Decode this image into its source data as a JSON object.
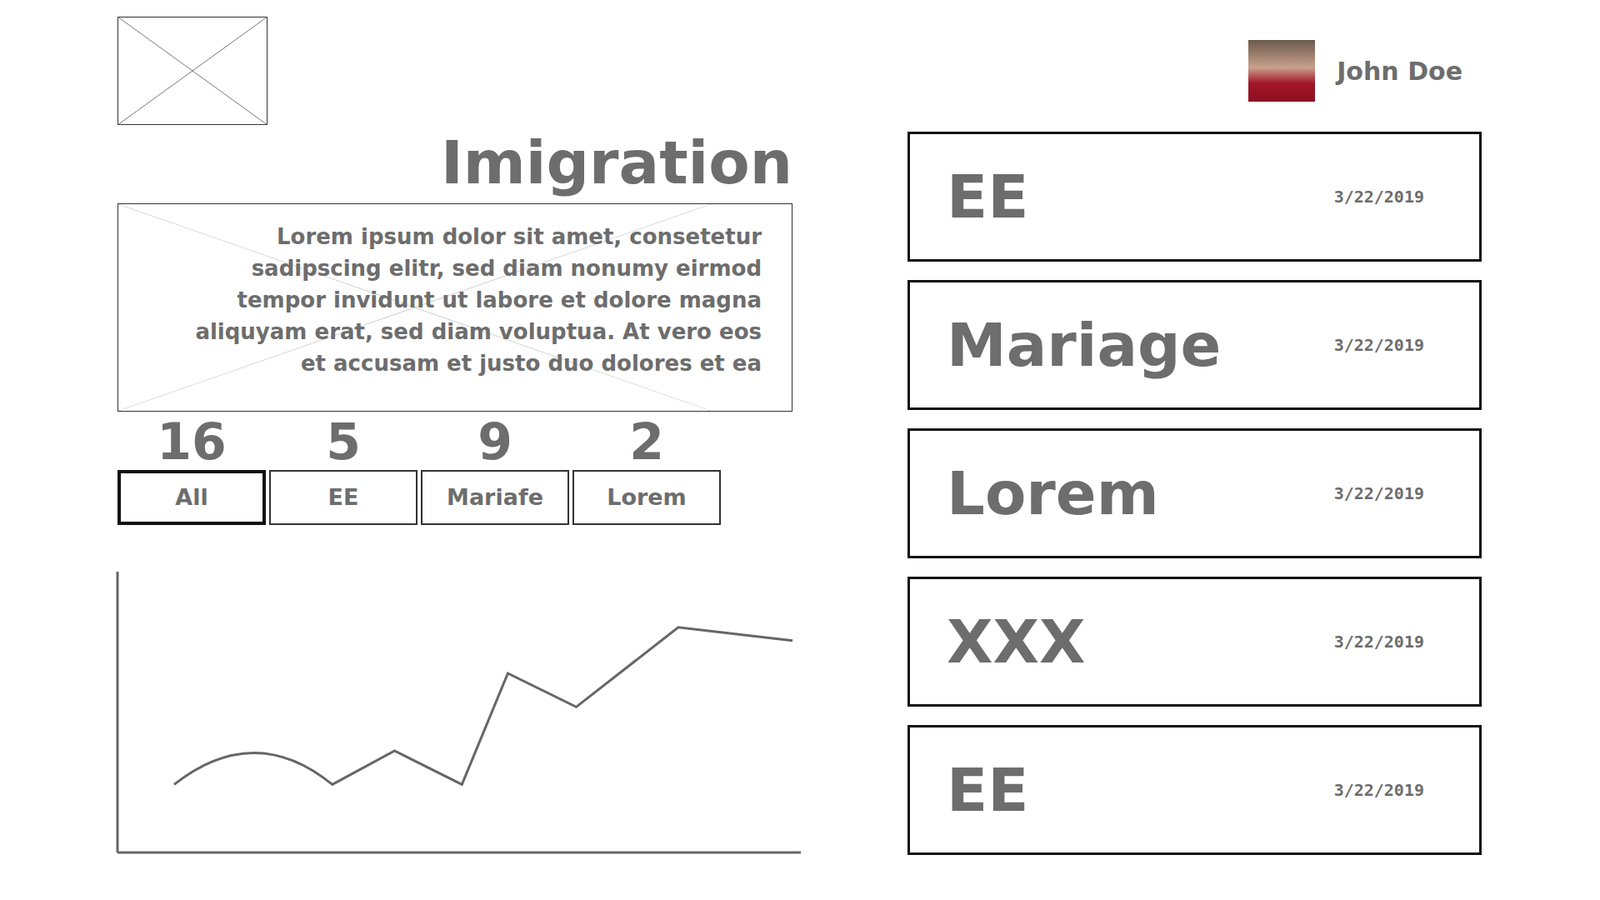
{
  "header": {
    "title": "Imigration",
    "description": "Lorem ipsum dolor sit amet, consetetur sadipscing elitr, sed diam nonumy eirmod tempor invidunt ut labore et dolore magna aliquyam erat, sed diam voluptua. At vero eos et accusam et justo duo dolores et ea"
  },
  "user": {
    "name": "John Doe"
  },
  "filters": [
    {
      "label": "All",
      "count": "16",
      "selected": true
    },
    {
      "label": "EE",
      "count": "5",
      "selected": false
    },
    {
      "label": "Mariafe",
      "count": "9",
      "selected": false
    },
    {
      "label": "Lorem",
      "count": "2",
      "selected": false
    }
  ],
  "chart": {
    "series": [
      {
        "x": [
          0,
          79,
          155,
          216,
          282,
          327,
          394,
          494,
          606
        ],
        "values": [
          65,
          96,
          65,
          98,
          65,
          174,
          141,
          219,
          206
        ]
      }
    ]
  },
  "cases": [
    {
      "title": "EE",
      "date": "3/22/2019"
    },
    {
      "title": "Mariage",
      "date": "3/22/2019"
    },
    {
      "title": "Lorem",
      "date": "3/22/2019"
    },
    {
      "title": "XXX",
      "date": "3/22/2019"
    },
    {
      "title": "EE",
      "date": "3/22/2019"
    }
  ]
}
